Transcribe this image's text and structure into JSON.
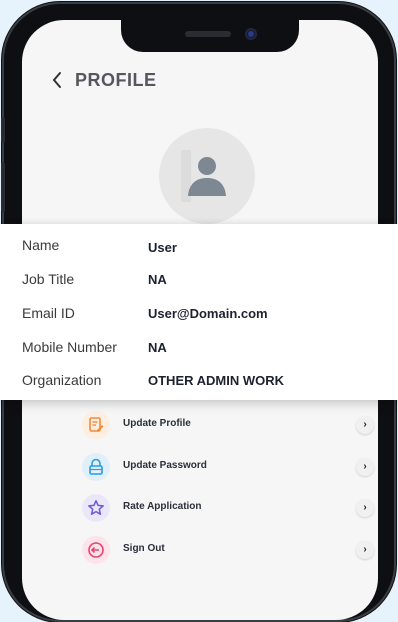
{
  "header": {
    "back_icon": "chevron-left-icon",
    "title": "PROFILE"
  },
  "avatar": {
    "icon": "user-silhouette-icon"
  },
  "profile": {
    "fields": [
      {
        "label": "Name",
        "value": "User"
      },
      {
        "label": "Job Title",
        "value": "NA"
      },
      {
        "label": "Email ID",
        "value": "User@Domain.com"
      },
      {
        "label": "Mobile Number",
        "value": "NA"
      },
      {
        "label": "Organization",
        "value": "OTHER ADMIN WORK"
      }
    ]
  },
  "menu": {
    "items": [
      {
        "label": "Update Profile",
        "icon": "edit-document-icon",
        "color": "#f08a3c",
        "bg": "#fdeee0"
      },
      {
        "label": "Update Password",
        "icon": "lock-icon",
        "color": "#2b9be0",
        "bg": "#dff0fb"
      },
      {
        "label": "Rate Application",
        "icon": "star-icon",
        "color": "#6a5bd6",
        "bg": "#ebe7fb"
      },
      {
        "label": "Sign Out",
        "icon": "sign-out-icon",
        "color": "#e6456e",
        "bg": "#fde3ea"
      }
    ]
  },
  "colors": {
    "background": "#e7f3fc",
    "screen": "#f6f6f6"
  }
}
